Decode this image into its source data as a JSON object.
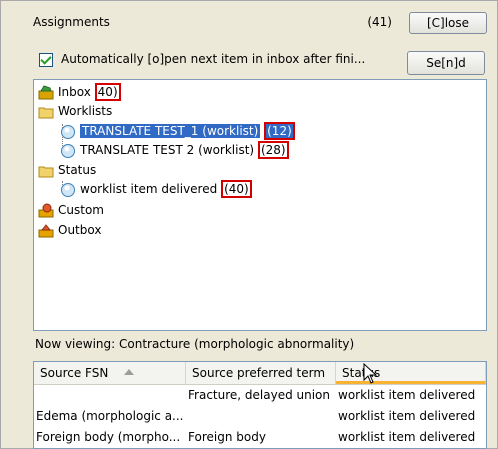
{
  "header": {
    "title": "Assignments",
    "count": "(41)",
    "close_label": "[C]lose"
  },
  "auto_open": {
    "checked": true,
    "label": "Automatically [o]pen next item in inbox after fini..."
  },
  "send_label": "Se[n]d",
  "tree": {
    "inbox": {
      "label": "Inbox",
      "count": "40)"
    },
    "worklists": {
      "label": "Worklists"
    },
    "worklist_1": {
      "label": "TRANSLATE TEST_1 (worklist)",
      "count": "(12)"
    },
    "worklist_2": {
      "label": "TRANSLATE TEST 2 (worklist)",
      "count": "(28)"
    },
    "status": {
      "label": "Status"
    },
    "status_item": {
      "label": "worklist item delivered",
      "count": "(40)"
    },
    "custom": {
      "label": "Custom"
    },
    "outbox": {
      "label": "Outbox"
    }
  },
  "viewing": {
    "label": "Now viewing:",
    "value": "Contracture (morphologic abnormality)"
  },
  "table": {
    "columns": [
      "Source FSN",
      "Source preferred term",
      "Status"
    ],
    "rows": [
      [
        "",
        "Fracture, delayed union",
        "worklist item delivered"
      ],
      [
        "Edema (morphologic a...",
        "",
        "worklist item delivered"
      ],
      [
        "Foreign body (morpho...",
        "Foreign body",
        "worklist item delivered"
      ]
    ]
  },
  "colors": {
    "highlight": "#316ac5",
    "count_box": "#d40000",
    "active_sort": "#f9b234"
  }
}
